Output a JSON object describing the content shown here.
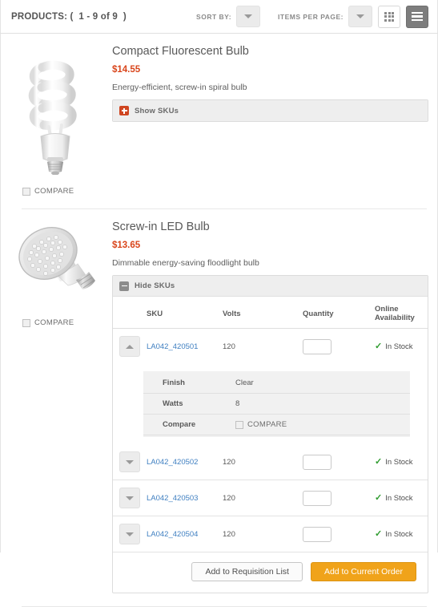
{
  "toolbar": {
    "products_label": "PRODUCTS: (  1 - 9 of 9  )",
    "sort_by_label": "SORT BY:",
    "sort_by_value": "",
    "items_per_page_label": "ITEMS PER PAGE:",
    "items_per_page_value": "",
    "grid_view_icon": "grid-view-icon",
    "list_view_icon": "list-view-icon"
  },
  "table_headers": {
    "sku": "SKU",
    "volts": "Volts",
    "quantity": "Quantity",
    "availability": "Online Availability"
  },
  "compare_label": "COMPARE",
  "colors": {
    "price": "#d9461c",
    "sku_link": "#3f7fc1",
    "in_stock": "#2e9b2e",
    "primary_button": "#f0a31a",
    "plus_icon": "#cf4520",
    "minus_icon": "#8c8c8c"
  },
  "products": [
    {
      "title": "Compact Fluorescent Bulb",
      "price": "$14.55",
      "description": "Energy-efficient, screw-in spiral bulb",
      "image_icon": "compact-fluorescent-bulb-image",
      "compare_label": "COMPARE",
      "skus_expanded": false,
      "toggle_label": "Show SKUs",
      "toggle_icon": "plus-icon",
      "skus": []
    },
    {
      "title": "Screw-in LED Bulb",
      "price": "$13.65",
      "description": "Dimmable energy-saving floodlight bulb",
      "image_icon": "screw-in-led-bulb-image",
      "compare_label": "COMPARE",
      "skus_expanded": true,
      "toggle_label": "Hide SKUs",
      "toggle_icon": "minus-icon",
      "skus": [
        {
          "sku": "LA042_420501",
          "volts": "120",
          "quantity": "",
          "availability": "In Stock",
          "expanded": true,
          "attributes": [
            {
              "key": "Finish",
              "value": "Clear"
            },
            {
              "key": "Watts",
              "value": "8"
            },
            {
              "key": "Compare",
              "value": "COMPARE"
            }
          ]
        },
        {
          "sku": "LA042_420502",
          "volts": "120",
          "quantity": "",
          "availability": "In Stock",
          "expanded": false,
          "attributes": []
        },
        {
          "sku": "LA042_420503",
          "volts": "120",
          "quantity": "",
          "availability": "In Stock",
          "expanded": false,
          "attributes": []
        },
        {
          "sku": "LA042_420504",
          "volts": "120",
          "quantity": "",
          "availability": "In Stock",
          "expanded": false,
          "attributes": []
        }
      ],
      "actions": {
        "requisition_label": "Add to Requisition List",
        "order_label": "Add to Current Order"
      }
    }
  ]
}
